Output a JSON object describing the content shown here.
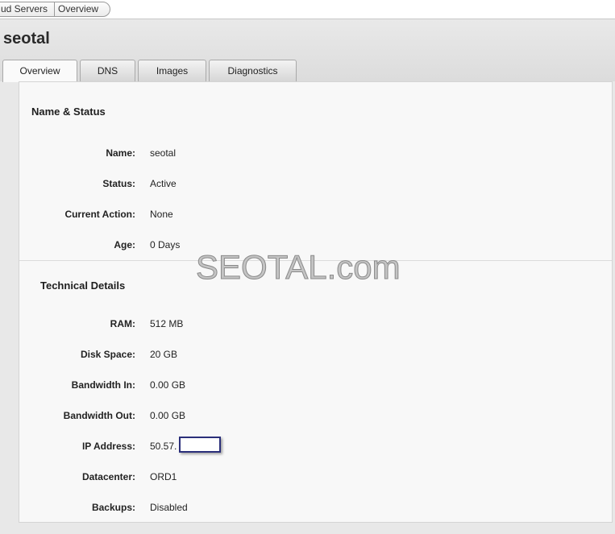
{
  "breadcrumb": {
    "items": [
      "ud Servers",
      "Overview"
    ]
  },
  "header": {
    "title": "seotal"
  },
  "tabs": [
    {
      "label": "Overview",
      "active": true
    },
    {
      "label": "DNS",
      "active": false
    },
    {
      "label": "Images",
      "active": false
    },
    {
      "label": "Diagnostics",
      "active": false
    }
  ],
  "name_status": {
    "title": "Name & Status",
    "rows": [
      {
        "label": "Name:",
        "value": "seotal"
      },
      {
        "label": "Status:",
        "value": "Active"
      },
      {
        "label": "Current Action:",
        "value": "None"
      },
      {
        "label": "Age:",
        "value": "0 Days"
      }
    ]
  },
  "technical": {
    "title": "Technical Details",
    "rows": [
      {
        "label": "RAM:",
        "value": "512 MB"
      },
      {
        "label": "Disk Space:",
        "value": "20 GB"
      },
      {
        "label": "Bandwidth In:",
        "value": "0.00 GB"
      },
      {
        "label": "Bandwidth Out:",
        "value": "0.00 GB"
      },
      {
        "label": "IP Address:",
        "value": "50.57."
      },
      {
        "label": "Datacenter:",
        "value": "ORD1"
      },
      {
        "label": "Backups:",
        "value": "Disabled"
      }
    ]
  },
  "watermark": "SEOTAL.com"
}
